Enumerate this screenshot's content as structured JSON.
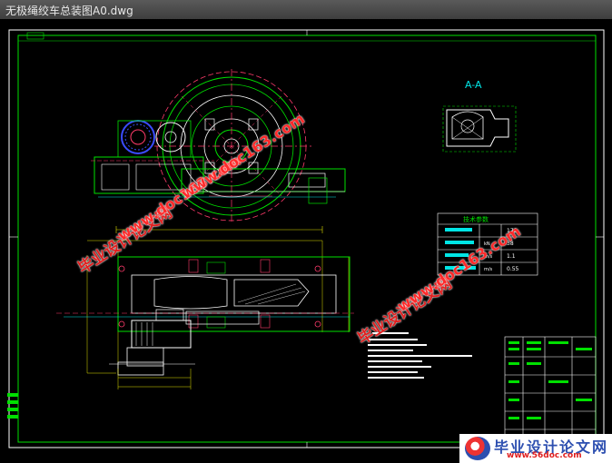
{
  "window": {
    "title": "无极绳绞车总装图A0.dwg"
  },
  "drawing": {
    "section_label": "A-A",
    "table_header": "技术参数",
    "params": [
      "170",
      "38",
      "1.1",
      "0.55"
    ],
    "units": [
      "kN",
      "m/s",
      "m/s"
    ],
    "colors": {
      "frame": "#ffffff",
      "outline": "#00e000",
      "accent": "#00e5e5",
      "dim": "#e0e000",
      "wheel": "#ff3b6b",
      "motor": "#3a4cff"
    }
  },
  "watermarks": [
    {
      "text": "毕业设计论文网",
      "kind": "cn"
    },
    {
      "text": "www.doc163.com",
      "kind": "url"
    },
    {
      "text": "毕业设计论文网",
      "kind": "cn"
    },
    {
      "text": "www.doc163.com",
      "kind": "url"
    },
    {
      "text": "www.doc163.com",
      "kind": "url"
    }
  ],
  "badge": {
    "title": "毕业设计论文网",
    "url": "www.56doc.com"
  }
}
